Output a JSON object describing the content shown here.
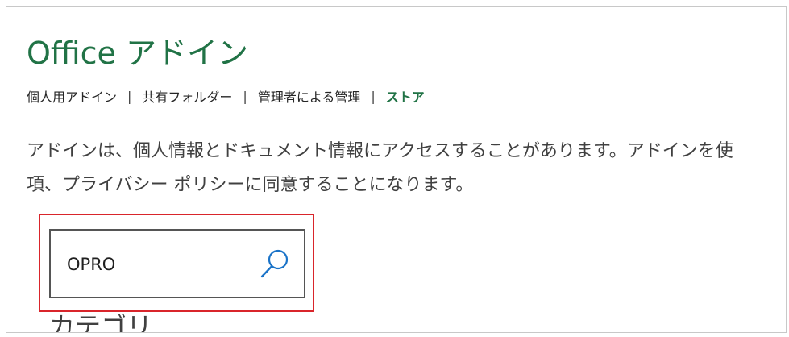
{
  "dialog": {
    "title": "Office アドイン"
  },
  "tabs": [
    {
      "label": "個人用アドイン",
      "active": false
    },
    {
      "label": "共有フォルダー",
      "active": false
    },
    {
      "label": "管理者による管理",
      "active": false
    },
    {
      "label": "ストア",
      "active": true
    }
  ],
  "tab_separator": "|",
  "description": {
    "line1": "アドインは、個人情報とドキュメント情報にアクセスすることがあります。アドインを使",
    "line2": "項、プライバシー ポリシーに同意することになります。"
  },
  "search": {
    "value": "OPRO",
    "icon": "search-icon"
  },
  "category_heading": "カテゴリ",
  "colors": {
    "accent": "#217346",
    "highlight_border": "#d9252b",
    "search_icon": "#1a73c8"
  }
}
